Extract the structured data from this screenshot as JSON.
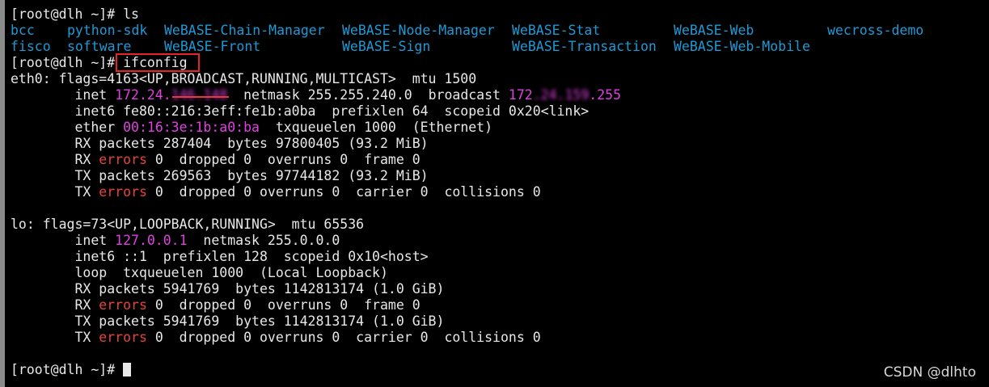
{
  "colors": {
    "background": "#000000",
    "text": "#e8e8e8",
    "directory": "#1c9ad6",
    "address": "#e040e0",
    "error_word": "#e8433a",
    "highlight_box": "#e32525"
  },
  "prompt": "[root@dlh ~]# ",
  "cmd_ls": "ls",
  "ls_output": {
    "row1": [
      "bcc",
      "python-sdk",
      "WeBASE-Chain-Manager",
      "WeBASE-Node-Manager",
      "WeBASE-Stat",
      "WeBASE-Web",
      "wecross-demo"
    ],
    "row2": [
      "fisco",
      "software",
      "WeBASE-Front",
      "WeBASE-Sign",
      "WeBASE-Transaction",
      "WeBASE-Web-Mobile"
    ]
  },
  "cmd_ifconfig": "ifconfig",
  "eth0": {
    "header": "eth0: flags=4163<UP,BROADCAST,RUNNING,MULTICAST>  mtu 1500",
    "inet_label": "        inet ",
    "inet_visible": "172.24.",
    "inet_blurred": "146.148",
    "netmask_text": "  netmask 255.255.240.0  broadcast ",
    "broadcast_visible": "172",
    "broadcast_blurred": ".24.159",
    "broadcast_end": ".255",
    "inet6": "        inet6 fe80::216:3eff:fe1b:a0ba  prefixlen 64  scopeid 0x20<link>",
    "ether_label": "        ether ",
    "ether_mac": "00:16:3e:1b:a0:ba",
    "ether_rest": "  txqueuelen 1000  (Ethernet)",
    "rx_packets": "        RX packets 287404  bytes 97800405 (93.2 MiB)",
    "rx_errors_pre": "        RX ",
    "errors_word": "errors",
    "rx_errors_post": " 0  dropped 0  overruns 0  frame 0",
    "tx_packets": "        TX packets 269563  bytes 97744182 (93.2 MiB)",
    "tx_errors_pre": "        TX ",
    "tx_errors_post": " 0  dropped 0 overruns 0  carrier 0  collisions 0"
  },
  "lo": {
    "header": "lo: flags=73<UP,LOOPBACK,RUNNING>  mtu 65536",
    "inet_label": "        inet ",
    "inet_addr": "127.0.0.1",
    "inet_rest": "  netmask 255.0.0.0",
    "inet6": "        inet6 ::1  prefixlen 128  scopeid 0x10<host>",
    "loop": "        loop  txqueuelen 1000  (Local Loopback)",
    "rx_packets": "        RX packets 5941769  bytes 1142813174 (1.0 GiB)",
    "rx_errors_pre": "        RX ",
    "rx_errors_post": " 0  dropped 0  overruns 0  frame 0",
    "tx_packets": "        TX packets 5941769  bytes 1142813174 (1.0 GiB)",
    "tx_errors_pre": "        TX ",
    "tx_errors_post": " 0  dropped 0 overruns 0  carrier 0  collisions 0"
  },
  "watermark": "CSDN @dlhto"
}
